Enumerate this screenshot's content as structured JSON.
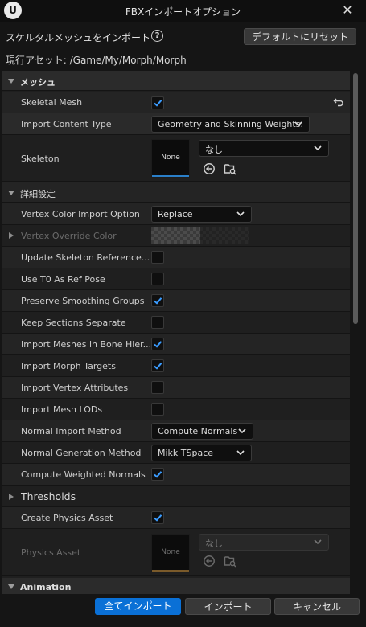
{
  "window": {
    "title": "FBXインポートオプション"
  },
  "header": {
    "label": "スケルタルメッシュをインポート",
    "reset_button": "デフォルトにリセット",
    "current_asset": "現行アセット: /Game/My/Morph/Morph"
  },
  "sections": {
    "mesh": "メッシュ",
    "advanced": "詳細設定",
    "thresholds": "Thresholds",
    "animation": "Animation"
  },
  "rows": {
    "skeletal_mesh": {
      "label": "Skeletal Mesh",
      "checked": true
    },
    "import_content_type": {
      "label": "Import Content Type",
      "value": "Geometry and Skinning Weights."
    },
    "skeleton": {
      "label": "Skeleton",
      "thumb": "None",
      "value": "なし"
    },
    "vertex_color_import_option": {
      "label": "Vertex Color Import Option",
      "value": "Replace"
    },
    "vertex_override_color": {
      "label": "Vertex Override Color"
    },
    "update_skeleton_reference": {
      "label": "Update Skeleton Reference...",
      "checked": false
    },
    "use_t0_as_ref_pose": {
      "label": "Use T0 As Ref Pose",
      "checked": false
    },
    "preserve_smoothing_groups": {
      "label": "Preserve Smoothing Groups",
      "checked": true
    },
    "keep_sections_separate": {
      "label": "Keep Sections Separate",
      "checked": false
    },
    "import_meshes_in_bone_hier": {
      "label": "Import Meshes in Bone Hier...",
      "checked": true
    },
    "import_morph_targets": {
      "label": "Import Morph Targets",
      "checked": true
    },
    "import_vertex_attributes": {
      "label": "Import Vertex Attributes",
      "checked": false
    },
    "import_mesh_lods": {
      "label": "Import Mesh LODs",
      "checked": false
    },
    "normal_import_method": {
      "label": "Normal Import Method",
      "value": "Compute Normals"
    },
    "normal_generation_method": {
      "label": "Normal Generation Method",
      "value": "Mikk TSpace"
    },
    "compute_weighted_normals": {
      "label": "Compute Weighted Normals",
      "checked": true
    },
    "create_physics_asset": {
      "label": "Create Physics Asset",
      "checked": true
    },
    "physics_asset": {
      "label": "Physics Asset",
      "thumb": "None",
      "value": "なし"
    }
  },
  "footer": {
    "import_all": "全てインポート",
    "import": "インポート",
    "cancel": "キャンセル"
  },
  "colors": {
    "accent": "#0a70d6",
    "panel": "#1f1f1f",
    "background": "#151515"
  }
}
